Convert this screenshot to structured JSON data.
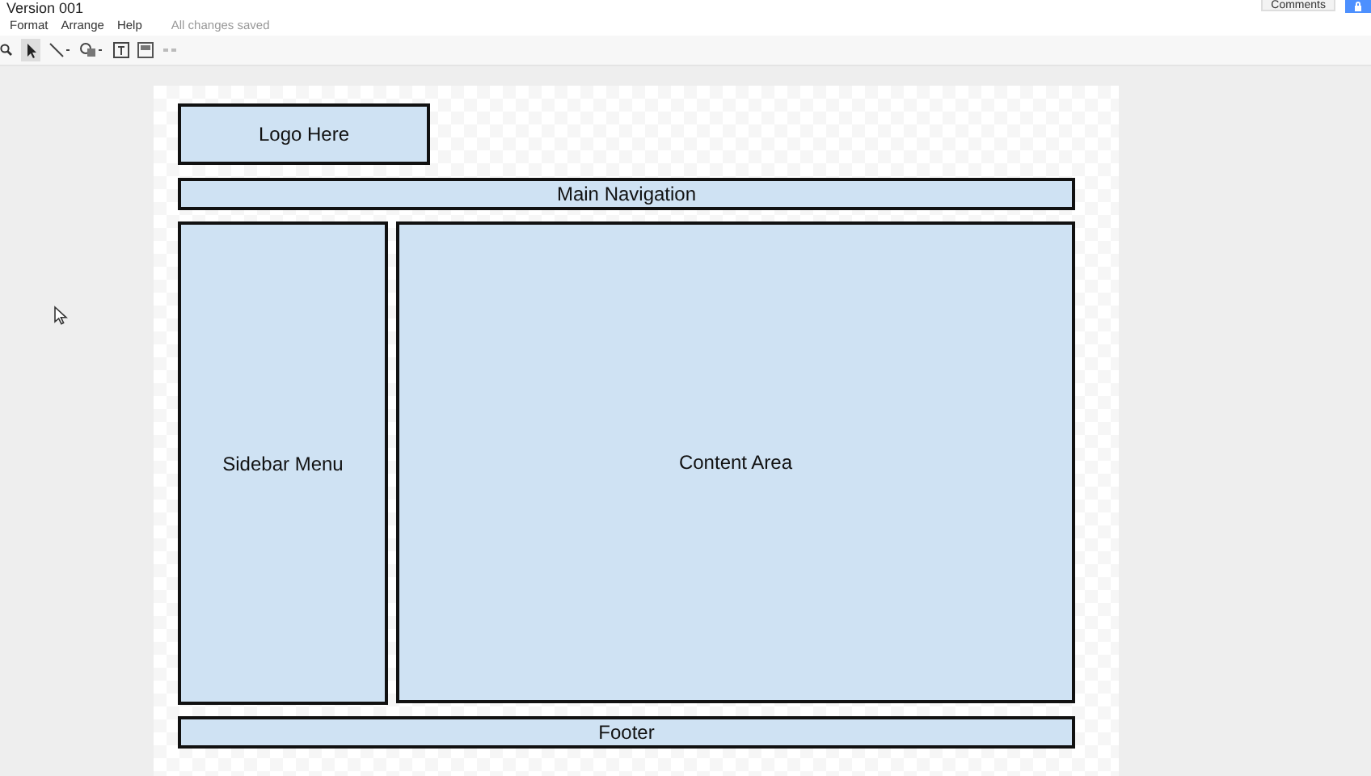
{
  "window": {
    "title": "Version 001"
  },
  "menu": [
    "Format",
    "Arrange",
    "Help"
  ],
  "save_status": "All changes saved",
  "comments_button": "Comments",
  "wireframe": [
    {
      "kind": "logo",
      "label": "Logo Here"
    },
    {
      "kind": "nav",
      "label": "Main Navigation"
    },
    {
      "kind": "sidebar",
      "label": "Sidebar Menu"
    },
    {
      "kind": "content",
      "label": "Content Area"
    },
    {
      "kind": "footer",
      "label": "Footer"
    }
  ]
}
